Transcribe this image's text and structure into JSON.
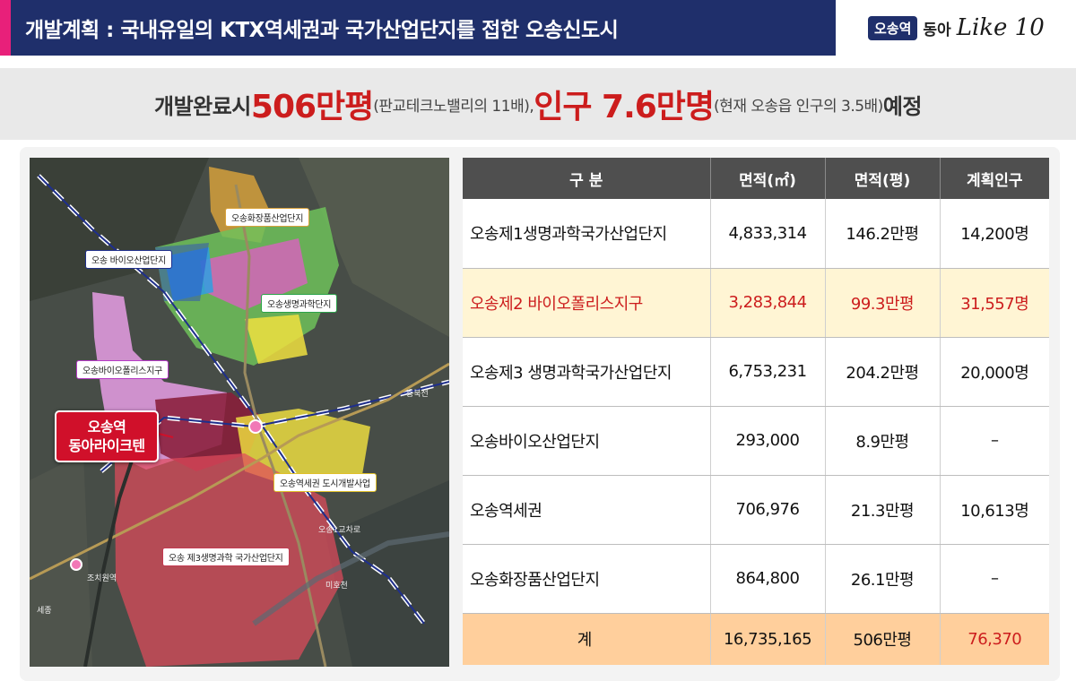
{
  "header": {
    "title": "개발계획 : 국내유일의 KTX역세권과 국가산업단지를 접한 오송신도시",
    "brand_badge": "오송역",
    "brand_name": "동아",
    "brand_script": "Like 10",
    "accent_color": "#e8207a",
    "bar_color": "#1f2f6b"
  },
  "summary": {
    "prefix": "개발완료시 ",
    "area_value": "506만평",
    "area_note": "(판교테크노밸리의 11배), ",
    "pop_value": "인구 7.6만명",
    "pop_note": "(현재 오송읍 인구의 3.5배)",
    "suffix": " 예정",
    "highlight_color": "#cc1d1d"
  },
  "map": {
    "labels": {
      "cosmetic": "오송화장품산업단지",
      "bio_industrial": "오송 바이오산업단지",
      "science": "오송생명과학단지",
      "biopolis": "오송바이오폴리스지구",
      "station_area": "오송역세권 도시개발사업",
      "third_complex": "오송 제3생명과학 국가산업단지"
    },
    "places": {
      "chungbuk_line": "충북선",
      "jochiwon_station": "조치원역",
      "osong_ic": "오송1교차로",
      "sejong": "세종",
      "mihocheon": "미호천"
    },
    "callout": {
      "line1": "오송역",
      "line2": "동아라이크텐"
    }
  },
  "table": {
    "headers": [
      "구 분",
      "면적(㎡)",
      "면적(평)",
      "계획인구"
    ],
    "rows": [
      {
        "name": "오송제1생명과학국가산업단지",
        "sqm": "4,833,314",
        "pyeong": "146.2만평",
        "pop": "14,200명"
      },
      {
        "name": "오송제2 바이오폴리스지구",
        "sqm": "3,283,844",
        "pyeong": "99.3만평",
        "pop": "31,557명"
      },
      {
        "name": "오송제3 생명과학국가산업단지",
        "sqm": "6,753,231",
        "pyeong": "204.2만평",
        "pop": "20,000명"
      },
      {
        "name": "오송바이오산업단지",
        "sqm": "293,000",
        "pyeong": "8.9만평",
        "pop": "–"
      },
      {
        "name": "오송역세권",
        "sqm": "706,976",
        "pyeong": "21.3만평",
        "pop": "10,613명"
      },
      {
        "name": "오송화장품산업단지",
        "sqm": "864,800",
        "pyeong": "26.1만평",
        "pop": "–"
      }
    ],
    "total": {
      "name": "계",
      "sqm": "16,735,165",
      "pyeong": "506만평",
      "pop": "76,370"
    }
  }
}
